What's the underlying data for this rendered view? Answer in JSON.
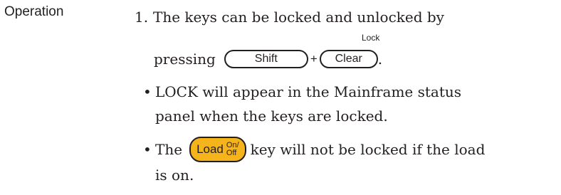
{
  "section": {
    "heading": "Operation"
  },
  "step": {
    "number": "1.",
    "line1": "The keys can be locked and unlocked by",
    "pressing": "pressing",
    "shift_key": "Shift",
    "plus": "+",
    "clear_key": "Clear",
    "clear_secondary_label": "Lock",
    "end_punct": "."
  },
  "bullets": [
    {
      "line1": "LOCK will appear in the Mainframe status",
      "line2": "panel when the keys are locked."
    },
    {
      "before": "The",
      "key_label": "Load",
      "key_sub_top": "On/",
      "key_sub_bottom": "Off",
      "after": "key will not be locked if the load",
      "line2": "is on."
    }
  ],
  "colors": {
    "load_key_fill": "#f5b31c",
    "text": "#231f20"
  }
}
